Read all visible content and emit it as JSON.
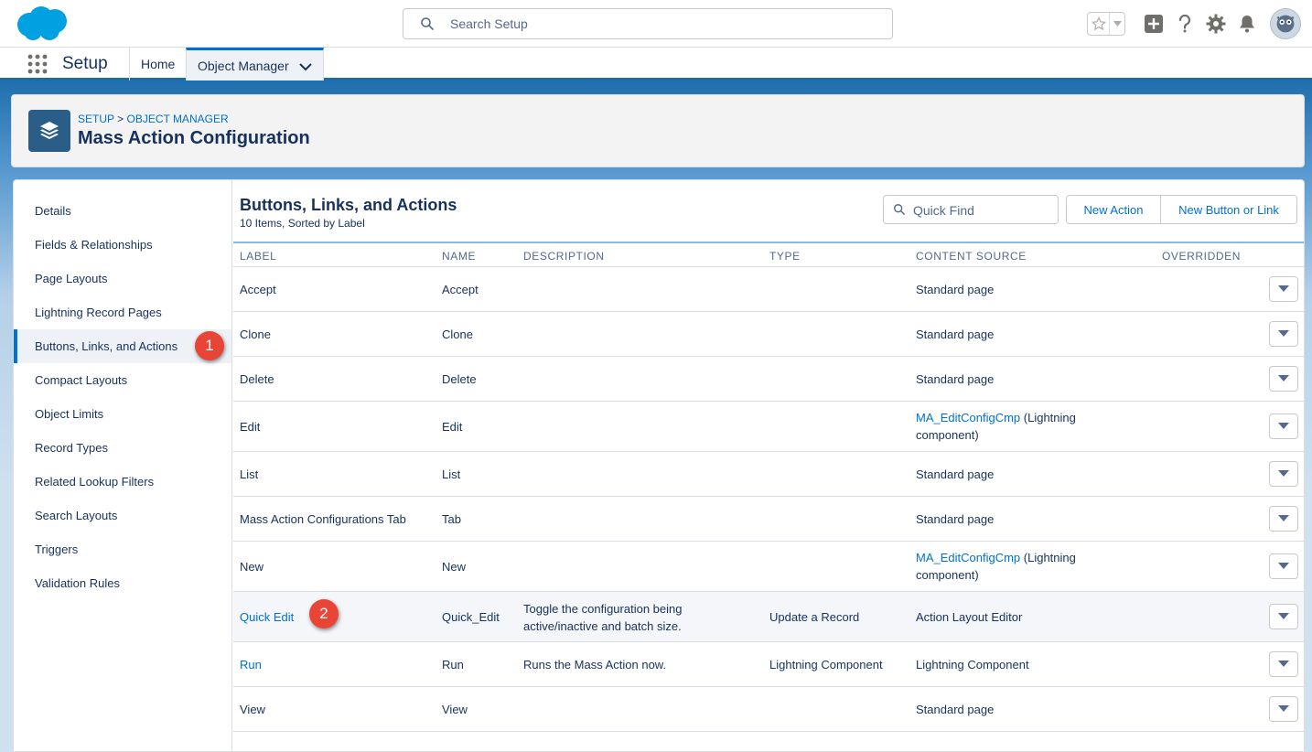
{
  "header": {
    "search_placeholder": "Search Setup",
    "icons": [
      "star-icon",
      "chevron-down-icon",
      "add-icon",
      "help-icon",
      "gear-icon",
      "bell-icon",
      "avatar-icon"
    ]
  },
  "context_bar": {
    "app_name": "Setup",
    "tabs": [
      {
        "label": "Home"
      },
      {
        "label": "Object Manager"
      }
    ]
  },
  "page_header": {
    "crumb_setup": "SETUP",
    "crumb_sep": " > ",
    "crumb_om": "OBJECT MANAGER",
    "title": "Mass Action Configuration"
  },
  "sidebar": {
    "items": [
      {
        "label": "Details"
      },
      {
        "label": "Fields & Relationships"
      },
      {
        "label": "Page Layouts"
      },
      {
        "label": "Lightning Record Pages"
      },
      {
        "label": "Buttons, Links, and Actions"
      },
      {
        "label": "Compact Layouts"
      },
      {
        "label": "Object Limits"
      },
      {
        "label": "Record Types"
      },
      {
        "label": "Related Lookup Filters"
      },
      {
        "label": "Search Layouts"
      },
      {
        "label": "Triggers"
      },
      {
        "label": "Validation Rules"
      }
    ],
    "active_index": 4
  },
  "main": {
    "title": "Buttons, Links, and Actions",
    "subtitle": "10 Items, Sorted by Label",
    "quick_find_placeholder": "Quick Find",
    "new_action_label": "New Action",
    "new_button_label": "New Button or Link",
    "columns": [
      "LABEL",
      "NAME",
      "DESCRIPTION",
      "TYPE",
      "CONTENT SOURCE",
      "OVERRIDDEN"
    ],
    "rows": [
      {
        "label": "Accept",
        "name": "Accept",
        "description": "",
        "type": "",
        "content_link": "",
        "content_text": "Standard page"
      },
      {
        "label": "Clone",
        "name": "Clone",
        "description": "",
        "type": "",
        "content_link": "",
        "content_text": "Standard page"
      },
      {
        "label": "Delete",
        "name": "Delete",
        "description": "",
        "type": "",
        "content_link": "",
        "content_text": "Standard page"
      },
      {
        "label": "Edit",
        "name": "Edit",
        "description": "",
        "type": "",
        "content_link": "MA_EditConfigCmp",
        "content_text": " (Lightning component)"
      },
      {
        "label": "List",
        "name": "List",
        "description": "",
        "type": "",
        "content_link": "",
        "content_text": "Standard page"
      },
      {
        "label": "Mass Action Configurations Tab",
        "name": "Tab",
        "description": "",
        "type": "",
        "content_link": "",
        "content_text": "Standard page"
      },
      {
        "label": "New",
        "name": "New",
        "description": "",
        "type": "",
        "content_link": "MA_EditConfigCmp",
        "content_text": " (Lightning component)"
      },
      {
        "label": "Quick Edit",
        "name": "Quick_Edit",
        "description": "Toggle the configuration being active/inactive and batch size.",
        "type": "Update a Record",
        "content_link": "",
        "content_text": "Action Layout Editor"
      },
      {
        "label": "Run",
        "name": "Run",
        "description": "Runs the Mass Action now.",
        "type": "Lightning Component",
        "content_link": "",
        "content_text": "Lightning Component"
      },
      {
        "label": "View",
        "name": "View",
        "description": "",
        "type": "",
        "content_link": "",
        "content_text": "Standard page"
      }
    ]
  },
  "callouts": [
    "1",
    "2"
  ]
}
